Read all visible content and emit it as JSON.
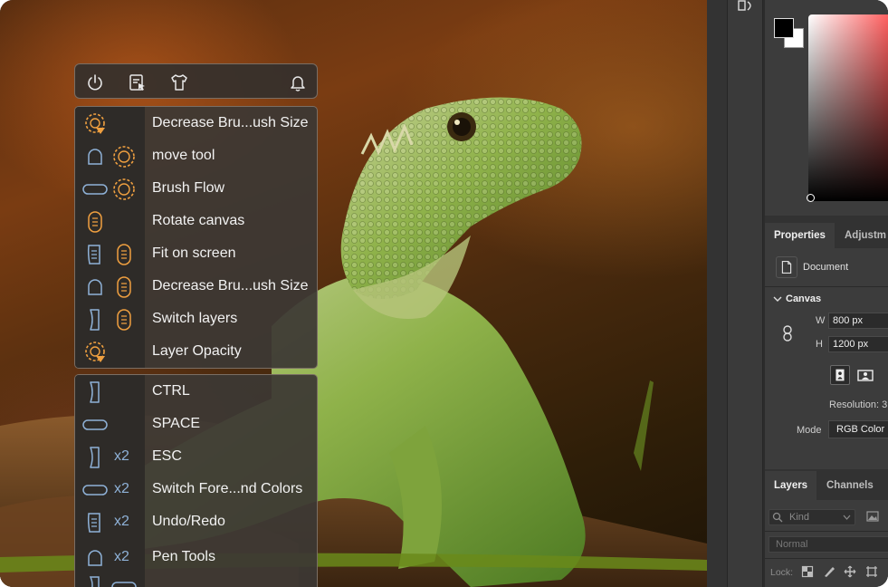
{
  "properties_panel": {
    "tabs": [
      "Properties",
      "Adjustm"
    ],
    "document_label": "Document",
    "canvas_section": "Canvas",
    "width_label": "W",
    "width_value": "800 px",
    "height_label": "H",
    "height_value": "1200 px",
    "resolution_label": "Resolution: 3",
    "mode_label": "Mode",
    "mode_value": "RGB Color"
  },
  "layers_panel": {
    "tabs": [
      "Layers",
      "Channels"
    ],
    "kind_placeholder": "Kind",
    "blend_mode": "Normal",
    "lock_label": "Lock:"
  },
  "color_panel": {
    "foreground": "#000000",
    "background": "#ffffff"
  },
  "overlay_topbar": {
    "icons": [
      "power-icon",
      "document-cursor-icon",
      "shirt-icon",
      "bell-icon"
    ]
  },
  "shortcuts_upper": [
    {
      "label": "Decrease Bru...ush Size",
      "keys": [
        "dial-press"
      ]
    },
    {
      "label": "move tool",
      "keys": [
        "mouse-left",
        "dial"
      ]
    },
    {
      "label": "Brush Flow",
      "keys": [
        "spacebar",
        "dial"
      ]
    },
    {
      "label": "Rotate canvas",
      "keys": [
        "scroll-wheel"
      ]
    },
    {
      "label": "Fit on screen",
      "keys": [
        "pen-button",
        "scroll-wheel"
      ]
    },
    {
      "label": "Decrease Bru...ush Size",
      "keys": [
        "mouse-left",
        "scroll-wheel"
      ]
    },
    {
      "label": "Switch layers",
      "keys": [
        "side-button",
        "scroll-wheel"
      ]
    },
    {
      "label": "Layer Opacity",
      "keys": [
        "dial-press"
      ]
    }
  ],
  "shortcuts_lower": [
    {
      "label": "CTRL",
      "keys": [
        "side-button"
      ],
      "multiplier": ""
    },
    {
      "label": "SPACE",
      "keys": [
        "spacebar"
      ],
      "multiplier": ""
    },
    {
      "label": "ESC",
      "keys": [
        "side-button"
      ],
      "multiplier": "x2"
    },
    {
      "label": "Switch Fore...nd Colors",
      "keys": [
        "spacebar"
      ],
      "multiplier": "x2"
    },
    {
      "label": "Undo/Redo",
      "keys": [
        "pen-button"
      ],
      "multiplier": "x2"
    },
    {
      "label": "Pen Tools",
      "keys": [
        "mouse-left"
      ],
      "multiplier": "x2"
    }
  ]
}
